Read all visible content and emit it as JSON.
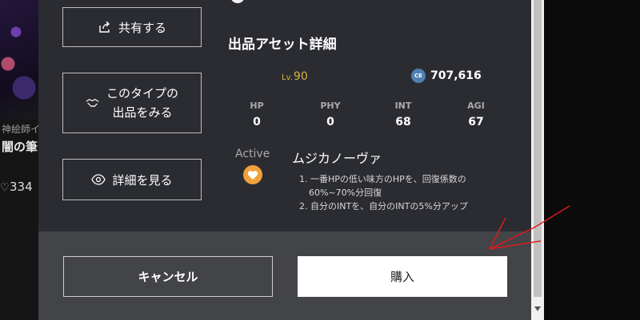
{
  "background": {
    "creator_text": "神絵師イ",
    "title_text": "闇の筆",
    "like_count": "334"
  },
  "modal": {
    "buttons": {
      "share": "共有する",
      "type_line1": "このタイプの",
      "type_line2": "出品をみる",
      "detail": "詳細を見る"
    },
    "section_title": "出品アセット詳細",
    "level": {
      "prefix": "Lv.",
      "value": "90"
    },
    "ce": {
      "badge": "CE",
      "value": "707,616"
    },
    "stats": [
      {
        "key": "HP",
        "value": "0"
      },
      {
        "key": "PHY",
        "value": "0"
      },
      {
        "key": "INT",
        "value": "68"
      },
      {
        "key": "AGI",
        "value": "67"
      }
    ],
    "skill": {
      "type": "Active",
      "name": "ムジカノーヴァ",
      "effects": [
        "1. 一番HPの低い味方のHPを、回復係数の",
        "60%~70%分回復",
        "2. 自分のINTを、自分のINTの5%分アップ"
      ]
    },
    "footer": {
      "cancel": "キャンセル",
      "buy": "購入"
    }
  },
  "colors": {
    "modal_bg": "#2b2c31",
    "footer_bg": "#434448",
    "level_gold": "#d7b53a",
    "skill_orange": "#f0a23a",
    "annotation_red": "#e01b1b"
  }
}
